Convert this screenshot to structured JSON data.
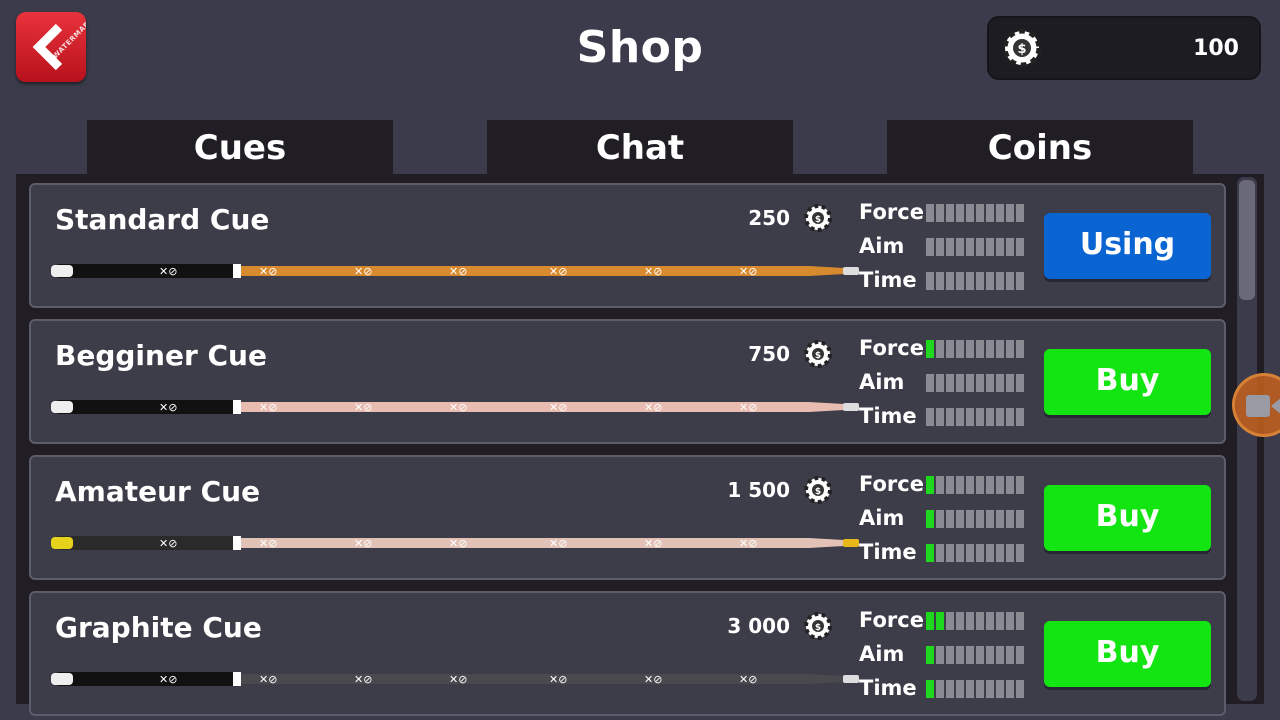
{
  "header": {
    "title": "Shop",
    "back_watermark": "WATERMARK",
    "coins_balance": "100"
  },
  "tabs": [
    {
      "label": "Cues"
    },
    {
      "label": "Chat"
    },
    {
      "label": "Coins"
    }
  ],
  "stat_labels": {
    "force": "Force",
    "aim": "Aim",
    "time": "Time"
  },
  "cues": [
    {
      "name": "Standard Cue",
      "price": "250",
      "force": 0,
      "aim": 0,
      "time": 0,
      "action": "Using",
      "state": "using",
      "shaft_color": "#d88a2e"
    },
    {
      "name": "Begginer Cue",
      "price": "750",
      "force": 1,
      "aim": 0,
      "time": 0,
      "action": "Buy",
      "state": "buy",
      "shaft_color": "#e8bcb0"
    },
    {
      "name": "Amateur Cue",
      "price": "1 500",
      "force": 1,
      "aim": 1,
      "time": 1,
      "action": "Buy",
      "state": "buy",
      "shaft_color": "#e2c2b6"
    },
    {
      "name": "Graphite Cue",
      "price": "3 000",
      "force": 2,
      "aim": 1,
      "time": 1,
      "action": "Buy",
      "state": "buy",
      "shaft_color": "#4a4a4e"
    }
  ],
  "stat_max": 10,
  "colors": {
    "background": "#3b3b4b",
    "panel": "#201e24",
    "using_button": "#0a64d2",
    "buy_button": "#12e512",
    "stat_on": "#1ed81e",
    "stat_off": "#8a8a92"
  }
}
